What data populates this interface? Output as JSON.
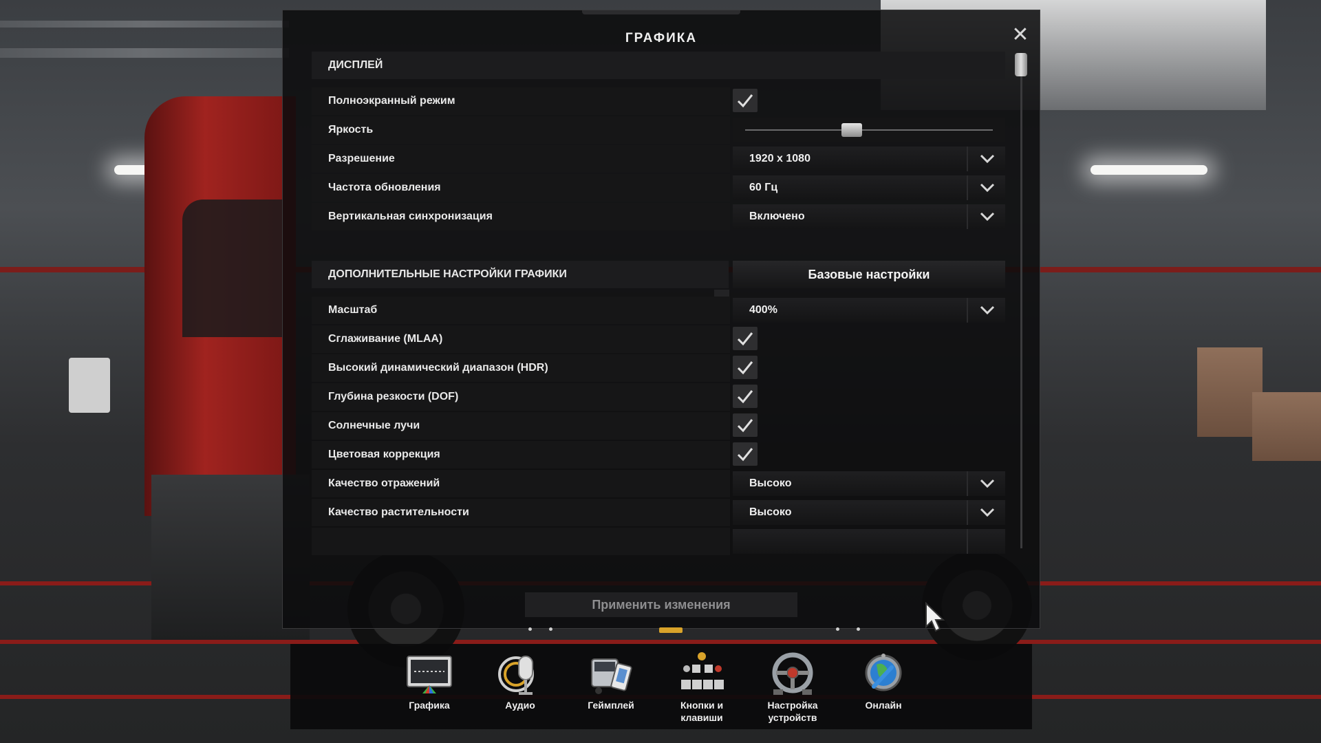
{
  "panel": {
    "title": "ГРАФИКА",
    "close_symbol": "✕"
  },
  "sections": {
    "display": "ДИСПЛЕЙ",
    "advanced": "ДОПОЛНИТЕЛЬНЫЕ НАСТРОЙКИ ГРАФИКИ",
    "preset_button": "Базовые настройки"
  },
  "display_rows": [
    {
      "label": "Полноэкранный режим",
      "type": "checkbox",
      "checked": true
    },
    {
      "label": "Яркость",
      "type": "slider",
      "value_fraction": 0.43
    },
    {
      "label": "Разрешение",
      "type": "select",
      "value": "1920 x 1080"
    },
    {
      "label": "Частота обновления",
      "type": "select",
      "value": "60 Гц"
    },
    {
      "label": "Вертикальная синхронизация",
      "type": "select",
      "value": "Включено"
    }
  ],
  "advanced_rows": [
    {
      "label": "Масштаб",
      "type": "select",
      "value": "400%"
    },
    {
      "label": "Сглаживание (MLAA)",
      "type": "checkbox",
      "checked": true
    },
    {
      "label": "Высокий динамический диапазон (HDR)",
      "type": "checkbox",
      "checked": true
    },
    {
      "label": "Глубина резкости (DOF)",
      "type": "checkbox",
      "checked": true
    },
    {
      "label": "Солнечные лучи",
      "type": "checkbox",
      "checked": true
    },
    {
      "label": "Цветовая коррекция",
      "type": "checkbox",
      "checked": true
    },
    {
      "label": "Качество отражений",
      "type": "select",
      "value": "Высоко"
    },
    {
      "label": "Качество растительности",
      "type": "select",
      "value": "Высоко"
    }
  ],
  "apply_button": "Применить изменения",
  "nav": [
    {
      "label": "Графика",
      "icon": "monitor-icon"
    },
    {
      "label": "Аудио",
      "icon": "microphone-icon"
    },
    {
      "label": "Геймплей",
      "icon": "truck-icon"
    },
    {
      "label": "Кнопки и клавиши",
      "icon": "controller-icon"
    },
    {
      "label": "Настройка устройств",
      "icon": "steering-wheel-icon"
    },
    {
      "label": "Онлайн",
      "icon": "globe-icon"
    }
  ],
  "colors": {
    "accent": "#d9a32a",
    "panel_bg": "#0c0c0d",
    "truck_red": "#a0231f"
  }
}
